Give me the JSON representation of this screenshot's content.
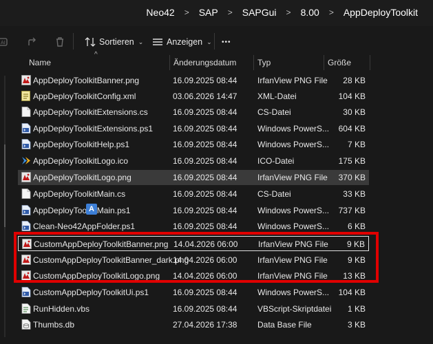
{
  "breadcrumb": [
    "Neo42",
    "SAP",
    "SAPGui",
    "8.00",
    "AppDeployToolkit"
  ],
  "toolbar": {
    "sort_label": "Sortieren",
    "view_label": "Anzeigen",
    "more_label": "•••"
  },
  "columns": {
    "name": "Name",
    "date": "Änderungsdatum",
    "type": "Typ",
    "size": "Größe"
  },
  "files": [
    {
      "name": "AppDeployToolkitBanner.png",
      "date": "16.09.2025 08:44",
      "type": "IrfanView PNG File",
      "size": "28 KB",
      "icon": "png-icon"
    },
    {
      "name": "AppDeployToolkitConfig.xml",
      "date": "03.06.2026 14:47",
      "type": "XML-Datei",
      "size": "104 KB",
      "icon": "xml-icon"
    },
    {
      "name": "AppDeployToolkitExtensions.cs",
      "date": "16.09.2025 08:44",
      "type": "CS-Datei",
      "size": "30 KB",
      "icon": "file-icon"
    },
    {
      "name": "AppDeployToolkitExtensions.ps1",
      "date": "16.09.2025 08:44",
      "type": "Windows PowerS...",
      "size": "604 KB",
      "icon": "ps1-icon"
    },
    {
      "name": "AppDeployToolkitHelp.ps1",
      "date": "16.09.2025 08:44",
      "type": "Windows PowerS...",
      "size": "7 KB",
      "icon": "ps1-icon"
    },
    {
      "name": "AppDeployToolkitLogo.ico",
      "date": "16.09.2025 08:44",
      "type": "ICO-Datei",
      "size": "175 KB",
      "icon": "ico-icon"
    },
    {
      "name": "AppDeployToolkitLogo.png",
      "date": "16.09.2025 08:44",
      "type": "IrfanView PNG File",
      "size": "370 KB",
      "icon": "png-icon"
    },
    {
      "name": "AppDeployToolkitMain.cs",
      "date": "16.09.2025 08:44",
      "type": "CS-Datei",
      "size": "33 KB",
      "icon": "file-icon"
    },
    {
      "name": "AppDeployToolkitMain.ps1",
      "date": "16.09.2025 08:44",
      "type": "Windows PowerS...",
      "size": "737 KB",
      "icon": "ps1-icon"
    },
    {
      "name": "Clean-Neo42AppFolder.ps1",
      "date": "16.09.2025 08:44",
      "type": "Windows PowerS...",
      "size": "6 KB",
      "icon": "ps1-icon"
    },
    {
      "name": "CustomAppDeployToolkitBanner.png",
      "date": "14.04.2026 06:00",
      "type": "IrfanView PNG File",
      "size": "9 KB",
      "icon": "png-icon"
    },
    {
      "name": "CustomAppDeployToolkitBanner_dark.png",
      "date": "14.04.2026 06:00",
      "type": "IrfanView PNG File",
      "size": "9 KB",
      "icon": "png-icon"
    },
    {
      "name": "CustomAppDeployToolkitLogo.png",
      "date": "14.04.2026 06:00",
      "type": "IrfanView PNG File",
      "size": "13 KB",
      "icon": "png-icon"
    },
    {
      "name": "CustomAppDeployToolkitUi.ps1",
      "date": "16.09.2025 08:44",
      "type": "Windows PowerS...",
      "size": "104 KB",
      "icon": "ps1-icon"
    },
    {
      "name": "RunHidden.vbs",
      "date": "16.09.2025 08:44",
      "type": "VBScript-Skriptdatei",
      "size": "1 KB",
      "icon": "vbs-icon"
    },
    {
      "name": "Thumbs.db",
      "date": "27.04.2026 17:38",
      "type": "Data Base File",
      "size": "3 KB",
      "icon": "db-icon"
    }
  ],
  "colors": {
    "highlight": "#e00000",
    "selected_row": "#3a3a3a"
  }
}
